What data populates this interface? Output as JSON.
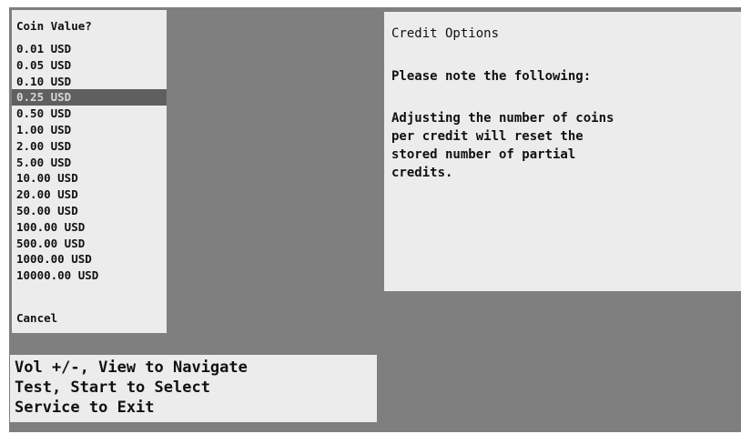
{
  "coin_menu": {
    "title": "Coin Value?",
    "options": [
      "0.01 USD",
      "0.05 USD",
      "0.10 USD",
      "0.25 USD",
      "0.50 USD",
      "1.00 USD",
      "2.00 USD",
      "5.00 USD",
      "10.00 USD",
      "20.00 USD",
      "50.00 USD",
      "100.00 USD",
      "500.00 USD",
      "1000.00 USD",
      "10000.00 USD"
    ],
    "selected": "0.25 USD",
    "cancel_label": "Cancel"
  },
  "info_panel": {
    "title": "Credit Options",
    "note": "Please note the following:",
    "body_lines": [
      "Adjusting the number of coins",
      "per credit will reset the",
      "stored number of partial",
      "credits."
    ]
  },
  "help": {
    "lines": [
      "Vol +/-, View to Navigate",
      "Test, Start to Select",
      "Service to Exit"
    ]
  },
  "colors": {
    "screen_background": "#7f7f7f",
    "panel_background": "#ececec",
    "highlight_background": "#5f5f5f",
    "highlight_text": "#d8d8d8",
    "text": "#111111"
  }
}
